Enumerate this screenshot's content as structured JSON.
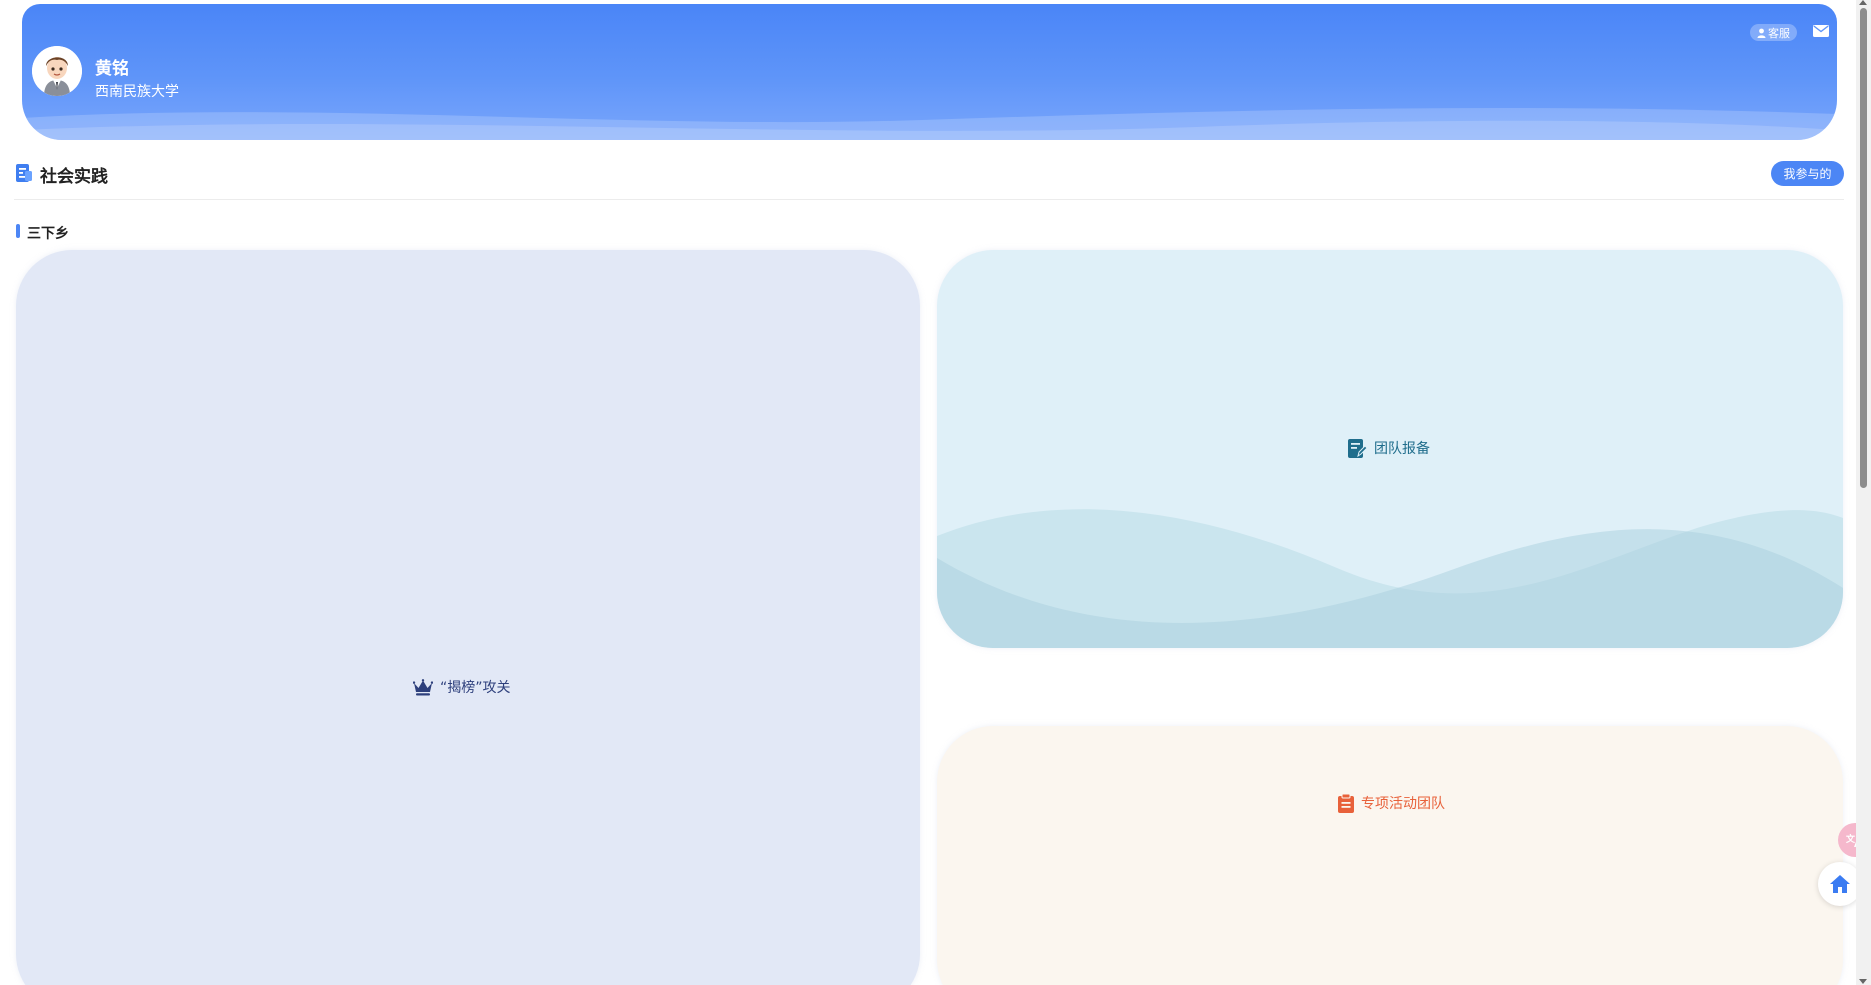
{
  "header": {
    "user_name": "黄铭",
    "school": "西南民族大学",
    "customer_service_label": "客服",
    "icons": [
      "avatar",
      "user-icon",
      "mail-icon"
    ]
  },
  "section": {
    "title": "社会实践",
    "mine_button_label": "我参与的",
    "icon": "report-icon"
  },
  "subsection": {
    "title": "三下乡"
  },
  "cards": [
    {
      "label": "“揭榜”攻关",
      "icon": "crown-icon",
      "color": "#2d3f7c",
      "background": "#e2e8f6"
    },
    {
      "label": "团队报备",
      "icon": "edit-document-icon",
      "color": "#1f6d8c",
      "background": "#dff0f8"
    },
    {
      "label": "专项活动团队",
      "icon": "clipboard-icon",
      "color": "#e8613a",
      "background": "#fbf6ef"
    }
  ],
  "floating": {
    "translate_icon": "translate-icon",
    "home_icon": "home-icon"
  },
  "colors": {
    "accent": "#4c86f5",
    "header_gradient_top": "#4a85f7",
    "header_gradient_bottom": "#7aa6fb"
  }
}
